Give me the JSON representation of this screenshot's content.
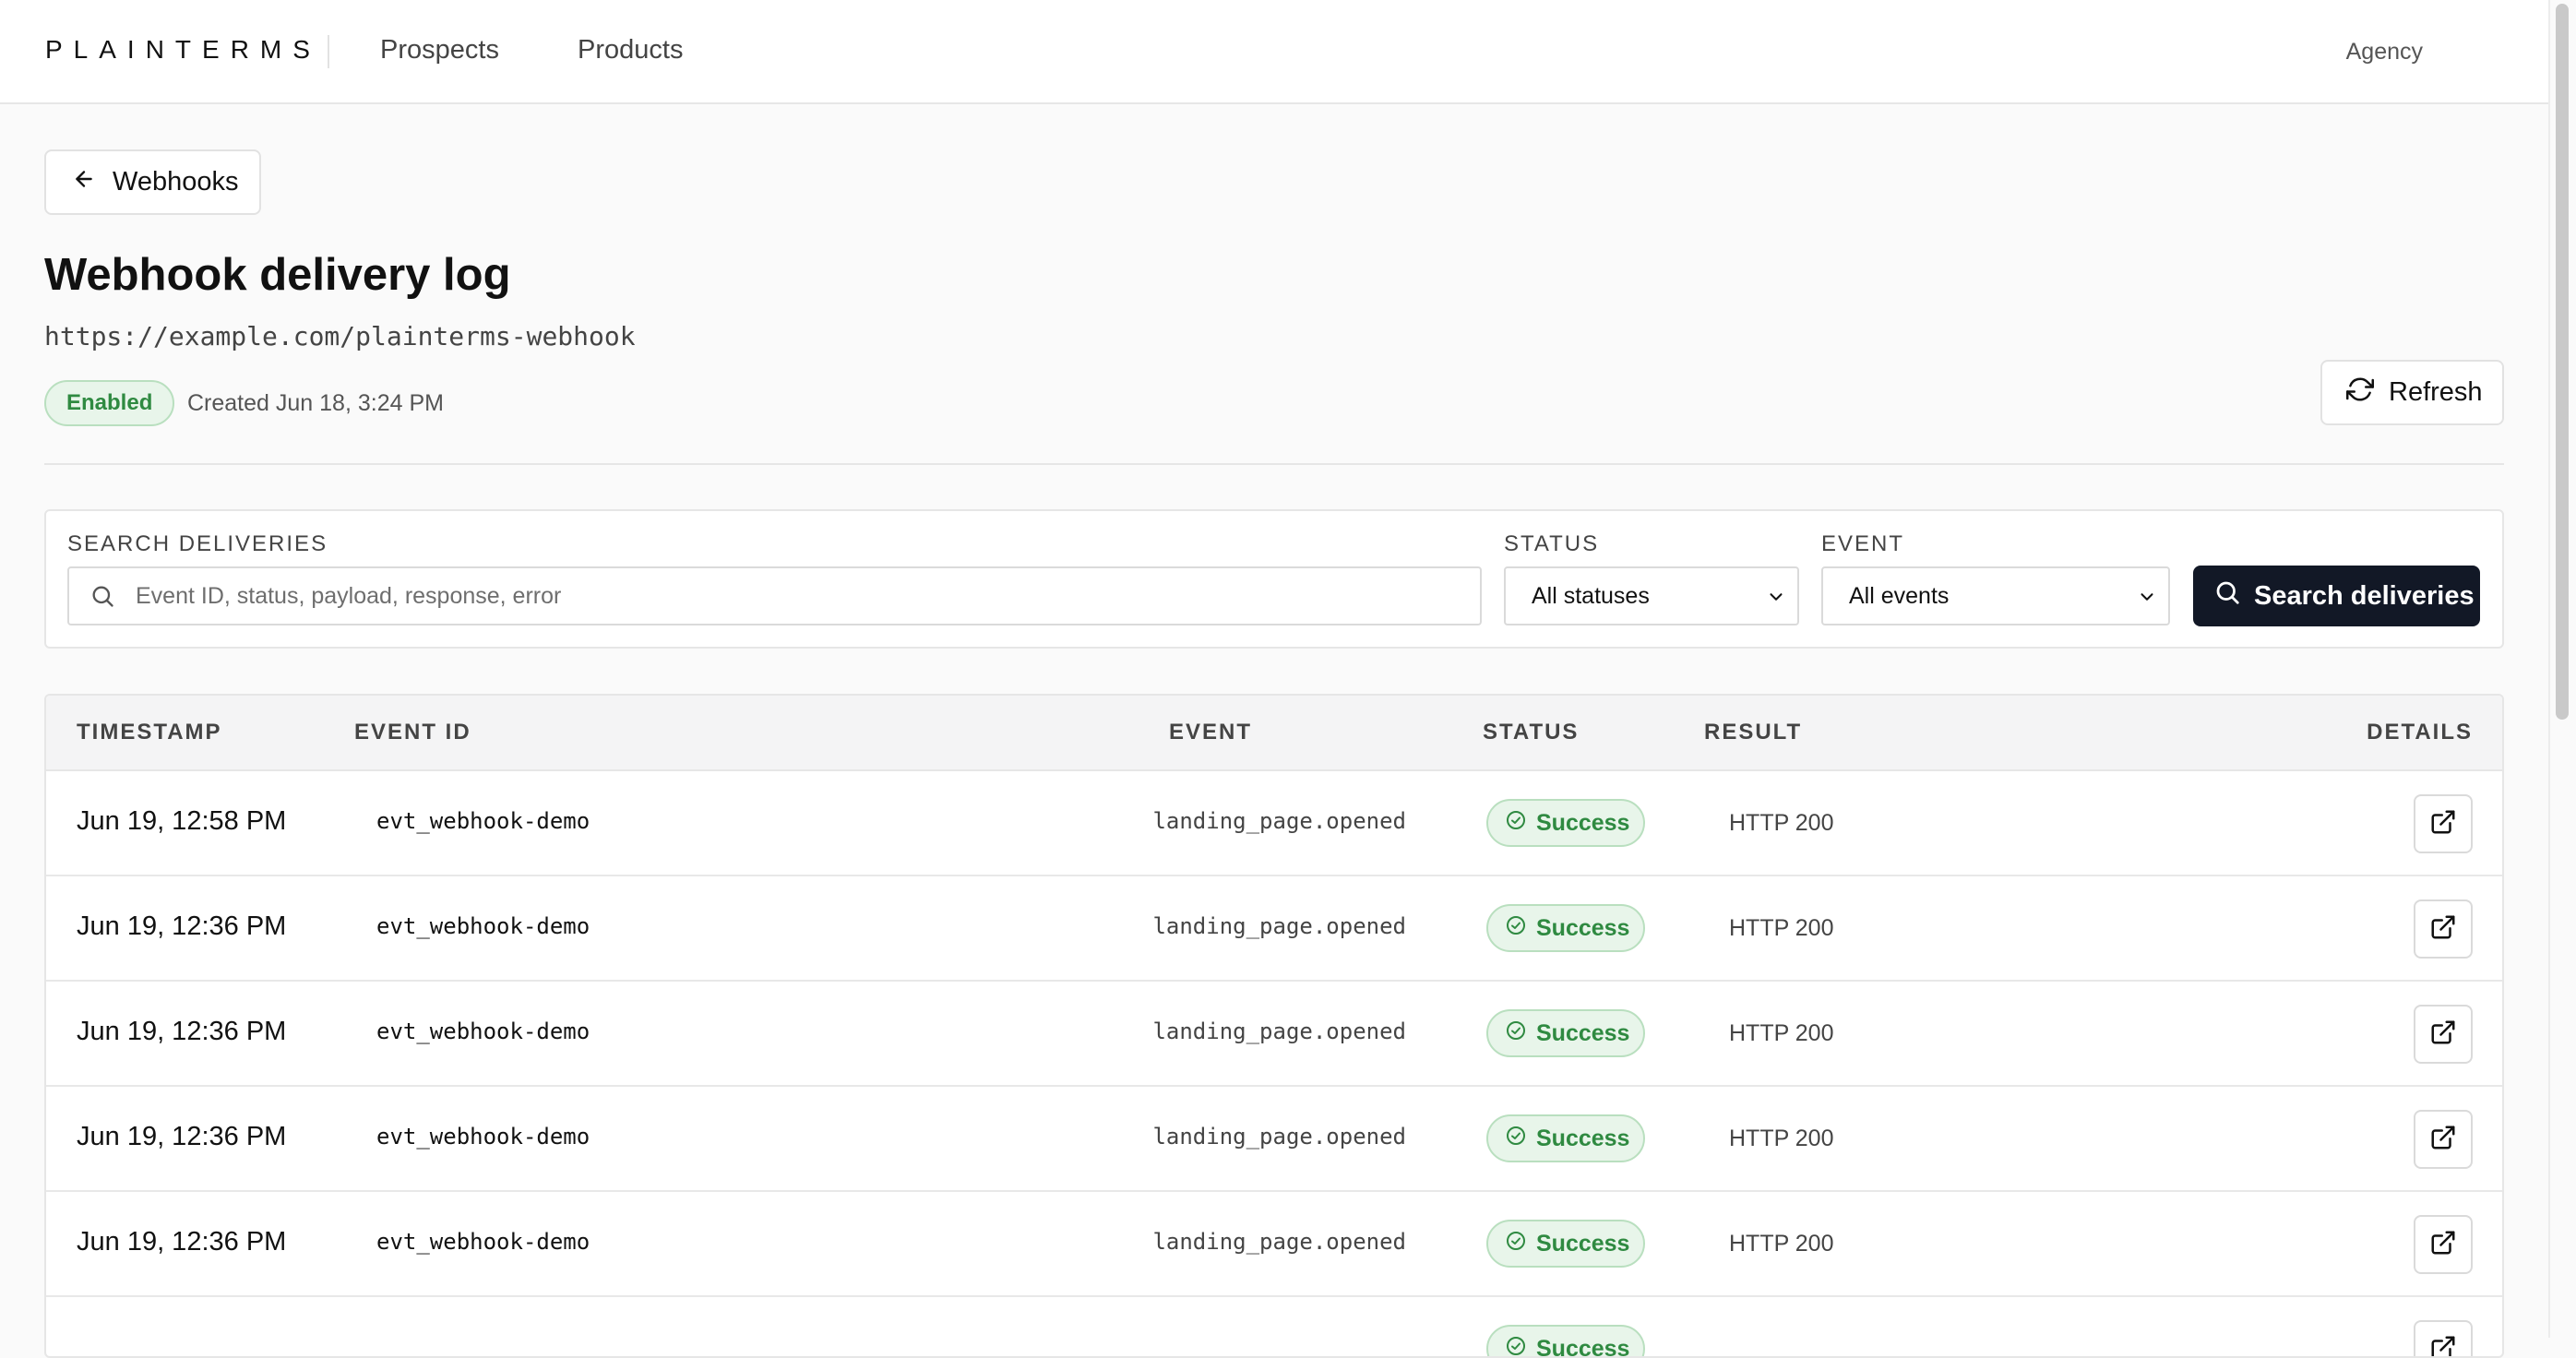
{
  "header": {
    "logo": "PLAINTERMS",
    "nav": [
      "Prospects",
      "Products"
    ],
    "account": "Agency"
  },
  "back_button": {
    "label": "Webhooks",
    "icon": "arrow-left-icon"
  },
  "page": {
    "title": "Webhook delivery log",
    "url": "https://example.com/plainterms-webhook",
    "status_badge": "Enabled",
    "created": "Created Jun 18, 3:24 PM",
    "refresh_label": "Refresh"
  },
  "filters": {
    "search_label": "SEARCH DELIVERIES",
    "search_placeholder": "Event ID, status, payload, response, error",
    "search_value": "",
    "status_label": "STATUS",
    "status_value": "All statuses",
    "event_label": "EVENT",
    "event_value": "All events",
    "submit_label": "Search deliveries"
  },
  "table": {
    "columns": [
      "TIMESTAMP",
      "EVENT ID",
      "EVENT",
      "STATUS",
      "RESULT",
      "DETAILS"
    ],
    "rows": [
      {
        "timestamp": "Jun 19, 12:58 PM",
        "event_id": "evt_webhook-demo",
        "event": "landing_page.opened",
        "status": "Success",
        "result": "HTTP 200"
      },
      {
        "timestamp": "Jun 19, 12:36 PM",
        "event_id": "evt_webhook-demo",
        "event": "landing_page.opened",
        "status": "Success",
        "result": "HTTP 200"
      },
      {
        "timestamp": "Jun 19, 12:36 PM",
        "event_id": "evt_webhook-demo",
        "event": "landing_page.opened",
        "status": "Success",
        "result": "HTTP 200"
      },
      {
        "timestamp": "Jun 19, 12:36 PM",
        "event_id": "evt_webhook-demo",
        "event": "landing_page.opened",
        "status": "Success",
        "result": "HTTP 200"
      },
      {
        "timestamp": "Jun 19, 12:36 PM",
        "event_id": "evt_webhook-demo",
        "event": "landing_page.opened",
        "status": "Success",
        "result": "HTTP 200"
      },
      {
        "timestamp": "",
        "event_id": "",
        "event": "",
        "status": "Success",
        "result": ""
      }
    ]
  },
  "colors": {
    "accent_dark": "#121826",
    "success_bg": "#e8f5ea",
    "success_text": "#2f8a41"
  }
}
